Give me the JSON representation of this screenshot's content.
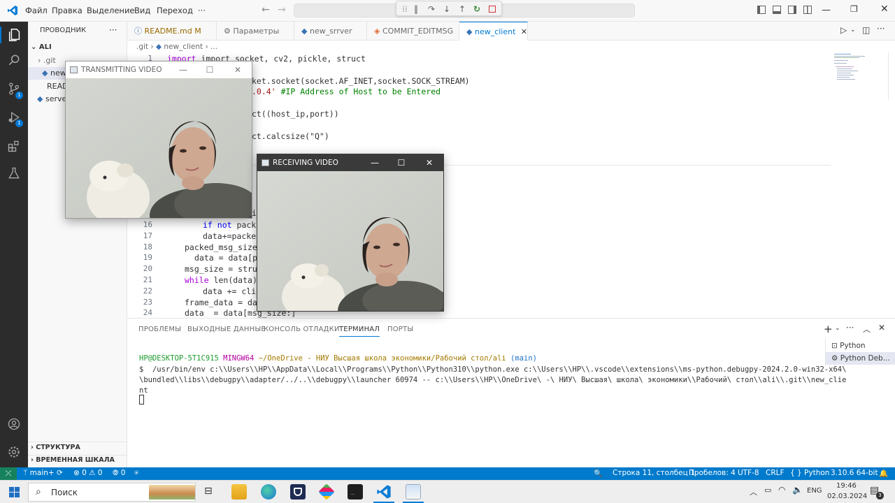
{
  "menu": [
    "Файл",
    "Правка",
    "Выделение",
    "Вид",
    "Переход",
    "···"
  ],
  "sidebar": {
    "title": "ПРОВОДНИК",
    "more": "···",
    "root": "ALI",
    "items": [
      "› .git",
      "new",
      "README",
      "server"
    ],
    "structure": "СТРУКТУРА",
    "timeline": "ВРЕМЕННАЯ ШКАЛА"
  },
  "badges": {
    "scm": "1",
    "debug": "1"
  },
  "tabs": [
    {
      "label": "README.md",
      "suffix": "M"
    },
    {
      "label": "Параметры",
      "suffix": ""
    },
    {
      "label": "new_srrver",
      "suffix": ""
    },
    {
      "label": "COMMIT_EDITMSG",
      "suffix": ""
    },
    {
      "label": "new_client",
      "suffix": ""
    }
  ],
  "breadcrumb": {
    "part1": ".git",
    "sep": "›",
    "part2": "new_client",
    "part3": "..."
  },
  "code": {
    "l1": "import socket, cv2, pickle, struct",
    "l3": "ket.socket(socket.AF_INET,socket.SOCK_STREAM)",
    "l4_str": ".0.4'",
    "l4_cm": "#IP Address of Host to be Entered",
    "l6": "ct((host_ip,port))",
    "l8": "ct.calcsize(\"Q\")",
    "l15": "i",
    "l16": "if not packe",
    "l17": "data+=packet",
    "l18": "packed_msg_size",
    "l19": "data = data[payl",
    "l20": "msg_size = struc",
    "l21_kw": "while",
    "l21": "len(data)",
    "l22": "data += clie",
    "l23": "frame_data = dat",
    "l24": "data  = data[msg_size:]"
  },
  "line_numbers": [
    "1",
    "16",
    "17",
    "18",
    "19",
    "20",
    "21",
    "22",
    "23",
    "24"
  ],
  "panel": {
    "tabs": [
      "ПРОБЛЕМЫ",
      "ВЫХОДНЫЕ ДАННЫЕ",
      "КОНСОЛЬ ОТЛАДКИ",
      "ТЕРМИНАЛ",
      "ПОРТЫ"
    ],
    "prompt_user": "HP@DESKTOP-5T1C915",
    "prompt_env": "MINGW64",
    "prompt_path": "~/OneDrive - НИУ Высшая школа экономики/Рабочий стол/ali",
    "prompt_branch": "(main)",
    "cmd1": "$  /usr/bin/env c:\\\\Users\\\\HP\\\\AppData\\\\Local\\\\Programs\\\\Python\\\\Python310\\\\python.exe c:\\\\Users\\\\HP\\\\.vscode\\\\extensions\\\\ms-python.debugpy-2024.2.0-win32-x64\\",
    "cmd2": "\\bundled\\\\libs\\\\debugpy\\\\adapter/../..\\\\debugpy\\\\launcher 60974 -- c:\\\\Users\\\\HP\\\\OneDrive\\ -\\ НИУ\\ Высшая\\ школа\\ экономики\\\\Рабочий\\ стол\\\\ali\\\\.git\\\\new_clie",
    "cmd3": "nt",
    "terminals": [
      "Python",
      "Python Deb..."
    ]
  },
  "status": {
    "branch": "main+",
    "errors": "0",
    "warnings": "0",
    "ports": "0",
    "position": "Строка 11, столбец 1",
    "spaces": "Пробелов: 4",
    "encoding": "UTF-8",
    "eol": "CRLF",
    "language": "Python",
    "interpreter": "3.10.6 64-bit"
  },
  "windows": {
    "transmit_title": "TRANSMITTING VIDEO",
    "receive_title": "RECEIVING VIDEO"
  },
  "taskbar": {
    "search": "Поиск",
    "lang": "ENG",
    "time": "19:46",
    "date": "02.03.2024",
    "notif": "3"
  },
  "colors": {
    "accent": "#0078d4",
    "statusbar": "#007acc",
    "activity": "#2c2c2c"
  }
}
